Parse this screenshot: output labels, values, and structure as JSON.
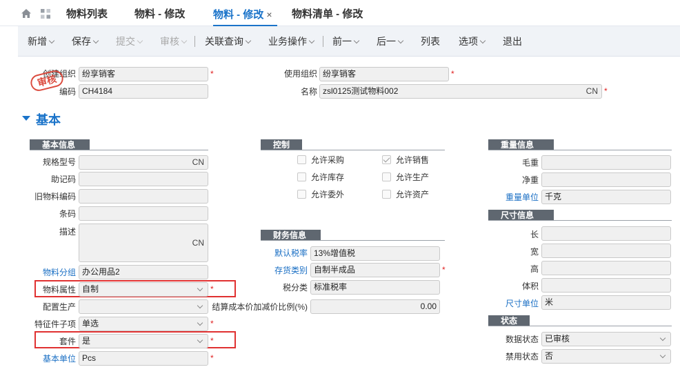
{
  "tabs": [
    {
      "label": "物料列表"
    },
    {
      "label": "物料 - 修改"
    },
    {
      "label": "物料 - 修改",
      "close": "×"
    },
    {
      "label": "物料清单 - 修改"
    }
  ],
  "toolbar": [
    {
      "label": "新增"
    },
    {
      "label": "保存"
    },
    {
      "label": "提交"
    },
    {
      "label": "审核"
    },
    {
      "label": "关联查询"
    },
    {
      "label": "业务操作"
    },
    {
      "label": "前一"
    },
    {
      "label": "后一"
    },
    {
      "label": "列表"
    },
    {
      "label": "选项"
    },
    {
      "label": "退出"
    }
  ],
  "header": {
    "create_org_label": "创建组织",
    "create_org_value": "纷享销客",
    "code_label": "编码",
    "code_value": "CH4184",
    "use_org_label": "使用组织",
    "use_org_value": "纷享销客",
    "name_label": "名称",
    "name_value": "zsl0125测试物料002",
    "lang_tag": "CN",
    "stamp": "审核"
  },
  "section_title": "基本",
  "basic": {
    "header": "基本信息",
    "spec_label": "规格型号",
    "spec_tag": "CN",
    "mnemonic_label": "助记码",
    "old_code_label": "旧物料编码",
    "barcode_label": "条码",
    "desc_label": "描述",
    "desc_tag": "CN",
    "group_label": "物料分组",
    "group_value": "办公用品2",
    "attr_label": "物料属性",
    "attr_value": "自制",
    "config_label": "配置生产",
    "feature_label": "特征件子项",
    "feature_value": "单选",
    "kit_label": "套件",
    "kit_value": "是",
    "unit_label": "基本单位",
    "unit_value": "Pcs"
  },
  "control": {
    "header": "控制",
    "items": [
      {
        "label": "允许采购",
        "checked": false
      },
      {
        "label": "允许销售",
        "checked": true
      },
      {
        "label": "允许库存",
        "checked": false
      },
      {
        "label": "允许生产",
        "checked": false
      },
      {
        "label": "允许委外",
        "checked": false
      },
      {
        "label": "允许资产",
        "checked": false
      }
    ]
  },
  "finance": {
    "header": "财务信息",
    "tax_rate_label": "默认税率",
    "tax_rate_value": "13%增值税",
    "stock_cat_label": "存货类别",
    "stock_cat_value": "自制半成品",
    "tax_cat_label": "税分类",
    "tax_cat_value": "标准税率",
    "cost_ratio_label": "结算成本价加减价比例(%)",
    "cost_ratio_value": "0.00"
  },
  "weight": {
    "header": "重量信息",
    "gross_label": "毛重",
    "net_label": "净重",
    "unit_label": "重量单位",
    "unit_value": "千克"
  },
  "size": {
    "header": "尺寸信息",
    "length_label": "长",
    "width_label": "宽",
    "height_label": "高",
    "volume_label": "体积",
    "unit_label": "尺寸单位",
    "unit_value": "米"
  },
  "status": {
    "header": "状态",
    "data_label": "数据状态",
    "data_value": "已审核",
    "forbid_label": "禁用状态",
    "forbid_value": "否"
  },
  "required_mark": "*",
  "colors": {
    "accent": "#1a73c9",
    "required": "#e02020",
    "highlight": "#e03030"
  }
}
